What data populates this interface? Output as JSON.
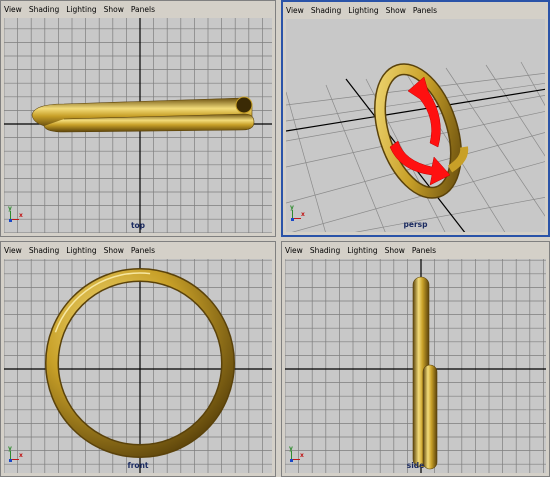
{
  "menu": [
    "View",
    "Shading",
    "Lighting",
    "Show",
    "Panels"
  ],
  "viewports": {
    "top": {
      "label": "top"
    },
    "persp": {
      "label": "persp"
    },
    "front": {
      "label": "front"
    },
    "side": {
      "label": "side"
    }
  },
  "axis": {
    "y": "y",
    "x": "x"
  },
  "colors": {
    "gold": "#c8a028",
    "gold_dark": "#6b5010",
    "gold_light": "#f3dc7a",
    "arrow": "#ff1010",
    "active_border": "#2a53a8",
    "grid": "#7e7e7e",
    "axis_line": "#000000"
  }
}
